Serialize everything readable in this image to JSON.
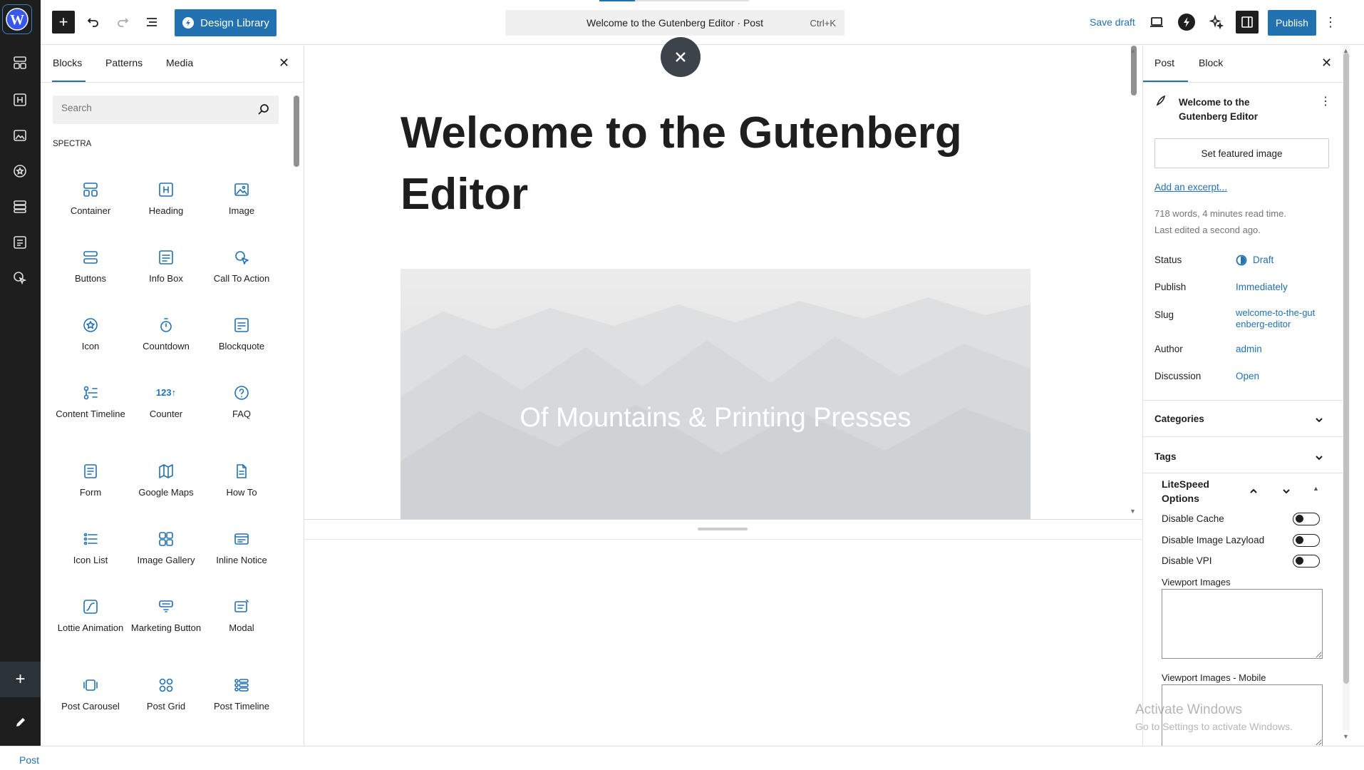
{
  "topbar": {
    "design_library_label": "Design Library",
    "doc_title": "Welcome to the Gutenberg Editor · Post",
    "shortcut": "Ctrl+K",
    "save_draft_label": "Save draft",
    "publish_label": "Publish"
  },
  "inserter": {
    "tabs": [
      "Blocks",
      "Patterns",
      "Media"
    ],
    "search_placeholder": "Search",
    "category": "SPECTRA",
    "blocks": [
      {
        "label": "Container",
        "icon": "container-icon"
      },
      {
        "label": "Heading",
        "icon": "heading-icon"
      },
      {
        "label": "Image",
        "icon": "image-icon"
      },
      {
        "label": "Buttons",
        "icon": "buttons-icon"
      },
      {
        "label": "Info Box",
        "icon": "info-box-icon"
      },
      {
        "label": "Call To Action",
        "icon": "call-to-action-icon"
      },
      {
        "label": "Icon",
        "icon": "icon-block-icon"
      },
      {
        "label": "Countdown",
        "icon": "countdown-icon"
      },
      {
        "label": "Blockquote",
        "icon": "blockquote-icon"
      },
      {
        "label": "Content Timeline",
        "icon": "content-timeline-icon"
      },
      {
        "label": "Counter",
        "icon": "counter-icon"
      },
      {
        "label": "FAQ",
        "icon": "faq-icon"
      },
      {
        "label": "Form",
        "icon": "form-icon"
      },
      {
        "label": "Google Maps",
        "icon": "google-maps-icon"
      },
      {
        "label": "How To",
        "icon": "how-to-icon"
      },
      {
        "label": "Icon List",
        "icon": "icon-list-icon"
      },
      {
        "label": "Image Gallery",
        "icon": "image-gallery-icon"
      },
      {
        "label": "Inline Notice",
        "icon": "inline-notice-icon"
      },
      {
        "label": "Lottie Animation",
        "icon": "lottie-icon"
      },
      {
        "label": "Marketing Button",
        "icon": "marketing-button-icon"
      },
      {
        "label": "Modal",
        "icon": "modal-icon"
      },
      {
        "label": "Post Carousel",
        "icon": "post-carousel-icon"
      },
      {
        "label": "Post Grid",
        "icon": "post-grid-icon"
      },
      {
        "label": "Post Timeline",
        "icon": "post-timeline-icon"
      }
    ],
    "counter_glyph": "123↑"
  },
  "canvas": {
    "title_line1": "Welcome to the Gutenberg",
    "title_line2": "Editor",
    "cover_text": "Of Mountains & Printing Presses"
  },
  "sidebar": {
    "tabs": [
      "Post",
      "Block"
    ],
    "post_title": "Welcome to the Gutenberg Editor",
    "featured_image_label": "Set featured image",
    "excerpt_link": "Add an excerpt...",
    "word_count": "718 words, 4 minutes read time.",
    "last_edited": "Last edited a second ago.",
    "rows": [
      {
        "label": "Status",
        "value": "Draft"
      },
      {
        "label": "Publish",
        "value": "Immediately"
      },
      {
        "label": "Slug",
        "value": "welcome-to-the-gutenberg-editor"
      },
      {
        "label": "Author",
        "value": "admin"
      },
      {
        "label": "Discussion",
        "value": "Open"
      }
    ],
    "categories_label": "Categories",
    "tags_label": "Tags",
    "litespeed": {
      "title": "LiteSpeed Options",
      "options": [
        "Disable Cache",
        "Disable Image Lazyload",
        "Disable VPI"
      ],
      "viewport_images": "Viewport Images",
      "viewport_images_mobile": "Viewport Images - Mobile"
    }
  },
  "footer": {
    "breadcrumb": "Post"
  },
  "watermark": {
    "line1": "Activate Windows",
    "line2": "Go to Settings to activate Windows."
  },
  "colors": {
    "accent": "#2271b1",
    "dark": "#1e1e1e"
  }
}
